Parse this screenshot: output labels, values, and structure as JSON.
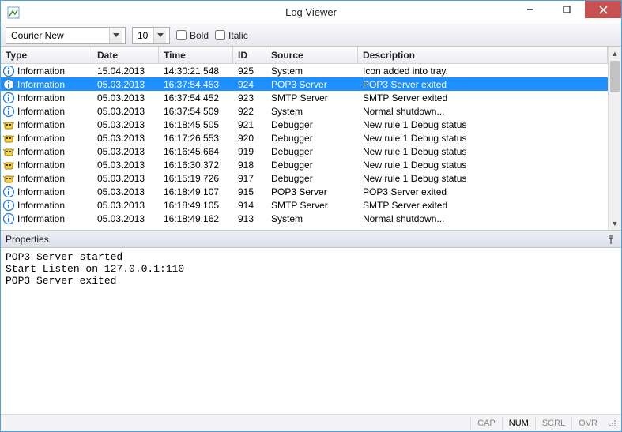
{
  "window": {
    "title": "Log Viewer"
  },
  "toolbar": {
    "font": "Courier New",
    "size": "10",
    "bold_label": "Bold",
    "italic_label": "Italic"
  },
  "columns": {
    "type": "Type",
    "date": "Date",
    "time": "Time",
    "id": "ID",
    "source": "Source",
    "description": "Description"
  },
  "rows": [
    {
      "icon": "info",
      "type": "Information",
      "date": "15.04.2013",
      "time": "14:30:21.548",
      "id": "925",
      "source": "System",
      "description": "Icon added into tray."
    },
    {
      "icon": "info",
      "type": "Information",
      "date": "05.03.2013",
      "time": "16:37:54.453",
      "id": "924",
      "source": "POP3 Server",
      "description": "POP3 Server exited",
      "selected": true
    },
    {
      "icon": "info",
      "type": "Information",
      "date": "05.03.2013",
      "time": "16:37:54.452",
      "id": "923",
      "source": "SMTP Server",
      "description": "SMTP Server exited"
    },
    {
      "icon": "info",
      "type": "Information",
      "date": "05.03.2013",
      "time": "16:37:54.509",
      "id": "922",
      "source": "System",
      "description": "Normal shutdown..."
    },
    {
      "icon": "bug",
      "type": "Information",
      "date": "05.03.2013",
      "time": "16:18:45.505",
      "id": "921",
      "source": "Debugger",
      "description": "New rule 1 Debug status"
    },
    {
      "icon": "bug",
      "type": "Information",
      "date": "05.03.2013",
      "time": "16:17:26.553",
      "id": "920",
      "source": "Debugger",
      "description": "New rule 1 Debug status"
    },
    {
      "icon": "bug",
      "type": "Information",
      "date": "05.03.2013",
      "time": "16:16:45.664",
      "id": "919",
      "source": "Debugger",
      "description": "New rule 1 Debug status"
    },
    {
      "icon": "bug",
      "type": "Information",
      "date": "05.03.2013",
      "time": "16:16:30.372",
      "id": "918",
      "source": "Debugger",
      "description": "New rule 1 Debug status"
    },
    {
      "icon": "bug",
      "type": "Information",
      "date": "05.03.2013",
      "time": "16:15:19.726",
      "id": "917",
      "source": "Debugger",
      "description": "New rule 1 Debug status"
    },
    {
      "icon": "info",
      "type": "Information",
      "date": "05.03.2013",
      "time": "16:18:49.107",
      "id": "915",
      "source": "POP3 Server",
      "description": "POP3 Server exited"
    },
    {
      "icon": "info",
      "type": "Information",
      "date": "05.03.2013",
      "time": "16:18:49.105",
      "id": "914",
      "source": "SMTP Server",
      "description": "SMTP Server exited"
    },
    {
      "icon": "info",
      "type": "Information",
      "date": "05.03.2013",
      "time": "16:18:49.162",
      "id": "913",
      "source": "System",
      "description": "Normal shutdown..."
    }
  ],
  "properties": {
    "title": "Properties",
    "text": "POP3 Server started\nStart Listen on 127.0.0.1:110\nPOP3 Server exited"
  },
  "status": {
    "cap": "CAP",
    "num": "NUM",
    "scrl": "SCRL",
    "ovr": "OVR"
  }
}
